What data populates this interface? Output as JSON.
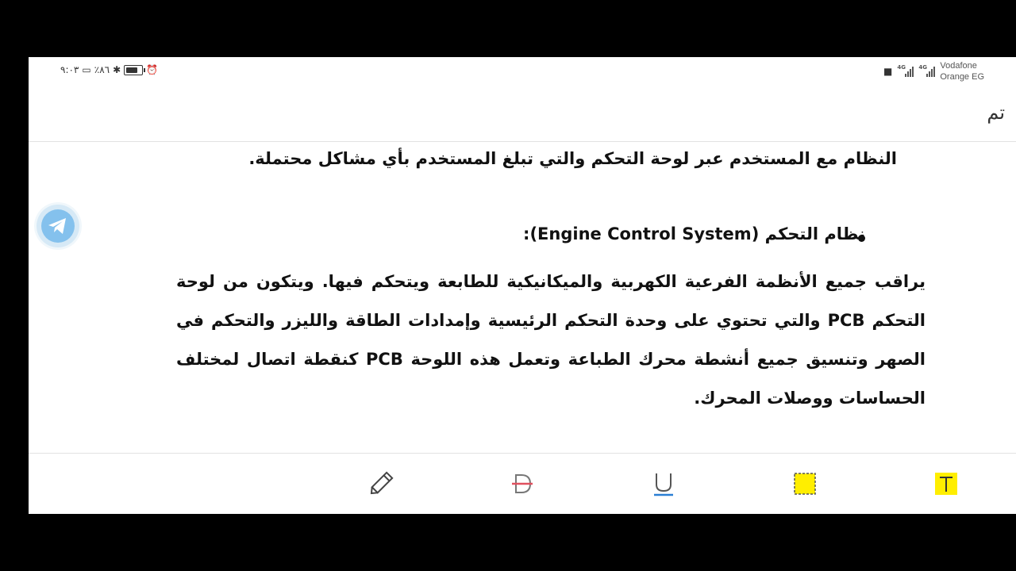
{
  "status_bar": {
    "time": "٩:٠٣",
    "battery": "٪٨٦",
    "carrier_1": "Vodafone",
    "carrier_2": "Orange EG",
    "network_1": "4G",
    "network_2": "4G"
  },
  "header": {
    "done_label": "تم"
  },
  "document": {
    "paragraph_1": "النظام مع المستخدم عبر لوحة التحكم والتي تبلغ المستخدم بأي مشاكل محتملة.",
    "bullet_heading": "نظام التحكم (Engine Control System):",
    "paragraph_2": "يراقب جميع الأنظمة الفرعية الكهربية والميكانيكية للطابعة ويتحكم فيها. ويتكون من لوحة التحكم PCB والتي تحتوي على وحدة التحكم الرئيسية وإمدادات الطاقة والليزر والتحكم في الصهر وتنسيق جميع أنشطة محرك الطباعة وتعمل هذه اللوحة PCB كنقطة اتصال لمختلف الحساسات ووصلات المحرك."
  },
  "toolbar": {
    "tools": [
      "pencil-icon",
      "strikethrough-icon",
      "underline-icon",
      "area-highlight-icon",
      "text-highlight-icon"
    ],
    "highlight_color": "#ffee00",
    "underline_color": "#2a7fd4",
    "strike_color": "#e0505f"
  },
  "telegram": {
    "color": "#54a9eb"
  }
}
